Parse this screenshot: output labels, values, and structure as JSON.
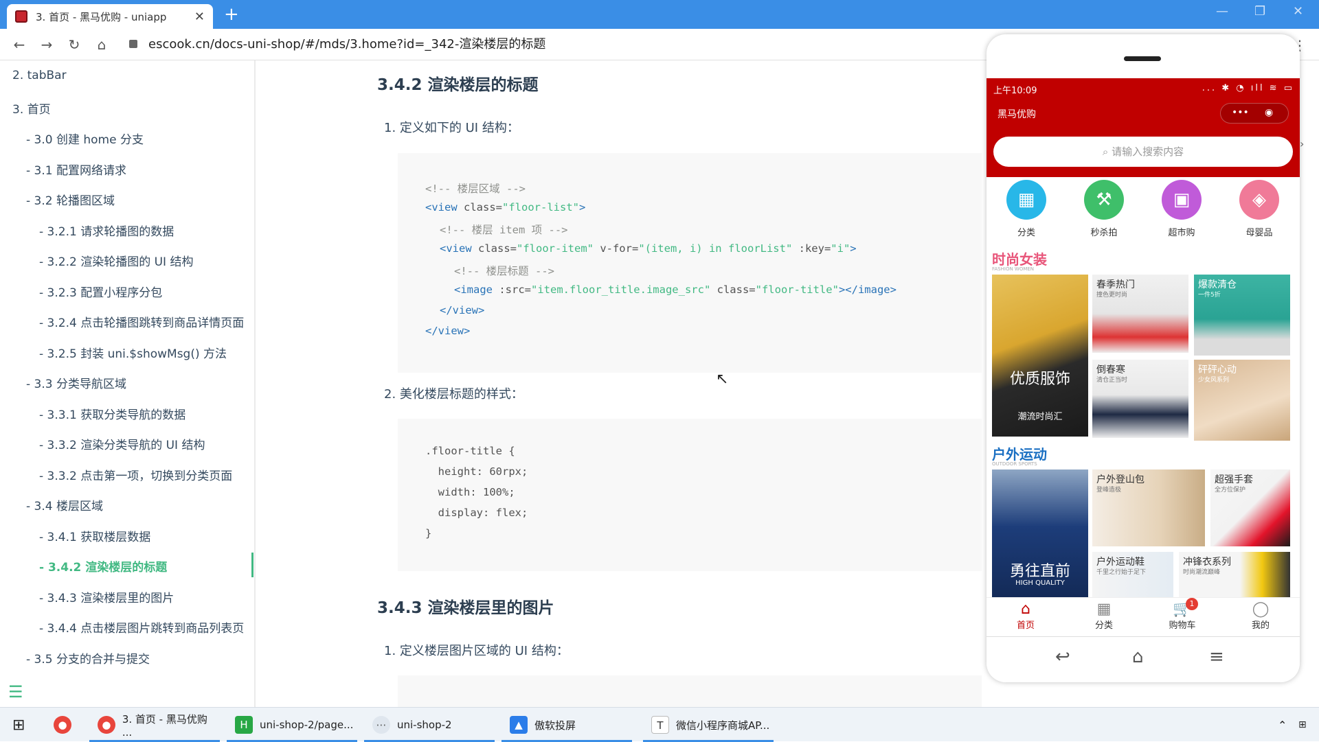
{
  "browser": {
    "tab_title": "3. 首页 - 黑马优购 - uniapp",
    "url": "escook.cn/docs-uni-shop/#/mds/3.home?id=_342-渲染楼层的标题"
  },
  "sidebar": {
    "items": [
      {
        "label": "2. tabBar"
      },
      {
        "label": "3. 首页"
      },
      {
        "label": "- 3.0 创建 home 分支"
      },
      {
        "label": "- 3.1 配置网络请求"
      },
      {
        "label": "- 3.2 轮播图区域"
      },
      {
        "label": "- 3.2.1 请求轮播图的数据"
      },
      {
        "label": "- 3.2.2 渲染轮播图的 UI 结构"
      },
      {
        "label": "- 3.2.3 配置小程序分包"
      },
      {
        "label": "- 3.2.4 点击轮播图跳转到商品详情页面"
      },
      {
        "label": "- 3.2.5 封装 uni.$showMsg() 方法"
      },
      {
        "label": "- 3.3 分类导航区域"
      },
      {
        "label": "- 3.3.1 获取分类导航的数据"
      },
      {
        "label": "- 3.3.2 渲染分类导航的 UI 结构"
      },
      {
        "label": "- 3.3.2 点击第一项，切换到分类页面"
      },
      {
        "label": "- 3.4 楼层区域"
      },
      {
        "label": "- 3.4.1 获取楼层数据"
      },
      {
        "label": "- 3.4.2 渲染楼层的标题"
      },
      {
        "label": "- 3.4.3 渲染楼层里的图片"
      },
      {
        "label": "- 3.4.4 点击楼层图片跳转到商品列表页"
      },
      {
        "label": "- 3.5 分支的合并与提交"
      }
    ]
  },
  "content": {
    "h_342": "3.4.2 渲染楼层的标题",
    "p1": "1. 定义如下的 UI 结构：",
    "code1": {
      "l1": "<!-- 楼层区域 -->",
      "l2a": "<view ",
      "l2b": "class=",
      "l2c": "\"floor-list\"",
      "l2d": ">",
      "l3": "<!-- 楼层 item 项 -->",
      "l4a": "<view ",
      "l4b": "class=",
      "l4c": "\"floor-item\"",
      "l4d": " v-for=",
      "l4e": "\"(item, i) in floorList\"",
      "l4f": " :key=",
      "l4g": "\"i\"",
      "l4h": ">",
      "l5": "<!-- 楼层标题 -->",
      "l6a": "<image ",
      "l6b": ":src=",
      "l6c": "\"item.floor_title.image_src\"",
      "l6d": " class=",
      "l6e": "\"floor-title\"",
      "l6f": "></image>",
      "l7": "</view>",
      "l8": "</view>"
    },
    "p2": "2. 美化楼层标题的样式：",
    "code2": {
      "l1": ".floor-title {",
      "l2": "  height: 60rpx;",
      "l3": "  width: 100%;",
      "l4": "  display: flex;",
      "l5": "}"
    },
    "h_343": "3.4.3 渲染楼层里的图片",
    "p3": "1. 定义楼层图片区域的 UI 结构："
  },
  "phone": {
    "time": "上午10:09",
    "status_icons": "... ✱ ◔ ıll ≋ ▭",
    "title": "黑马优购",
    "capsule_dots": "•••",
    "search_placeholder": "请输入搜索内容",
    "cats": [
      {
        "label": "分类",
        "color": "#28b7e8"
      },
      {
        "label": "秒杀拍",
        "color": "#3fbf6a"
      },
      {
        "label": "超市购",
        "color": "#c05bd9"
      },
      {
        "label": "母婴品",
        "color": "#f07a98"
      }
    ],
    "floor1": {
      "title": "时尚女装",
      "sub": "FASHION WOMEN",
      "color": "#e8557a",
      "big_label": "优质服饰",
      "big_sub": "潮流时尚汇",
      "tiles": [
        {
          "t": "春季热门",
          "s": "撞色更时尚"
        },
        {
          "t": "爆款清仓",
          "s": "一件5折"
        },
        {
          "t": "倒春寒",
          "s": "清仓正当时"
        },
        {
          "t": "砰砰心动",
          "s": "少女风系列"
        }
      ]
    },
    "floor2": {
      "title": "户外运动",
      "sub": "OUTDOOR SPORTS",
      "color": "#1a6fc2",
      "big_label": "勇往直前",
      "big_sub": "HIGH QUALITY",
      "tiles": [
        {
          "t": "户外登山包",
          "s": "登峰造极"
        },
        {
          "t": "超强手套",
          "s": "全方位保护"
        },
        {
          "t": "户外运动鞋",
          "s": "千里之行始于足下"
        },
        {
          "t": "冲锋衣系列",
          "s": "时尚潮流巅峰"
        }
      ]
    },
    "tabbar": [
      {
        "label": "首页",
        "icon": "⌂"
      },
      {
        "label": "分类",
        "icon": "▦"
      },
      {
        "label": "购物车",
        "icon": "🛒",
        "badge": "1"
      },
      {
        "label": "我的",
        "icon": "◯"
      }
    ]
  },
  "taskbar": {
    "items": [
      {
        "label": "3. 首页 - 黑马优购 ..."
      },
      {
        "label": "uni-shop-2/page..."
      },
      {
        "label": "uni-shop-2"
      },
      {
        "label": "傲软投屏"
      },
      {
        "label": "微信小程序商城AP..."
      }
    ]
  }
}
